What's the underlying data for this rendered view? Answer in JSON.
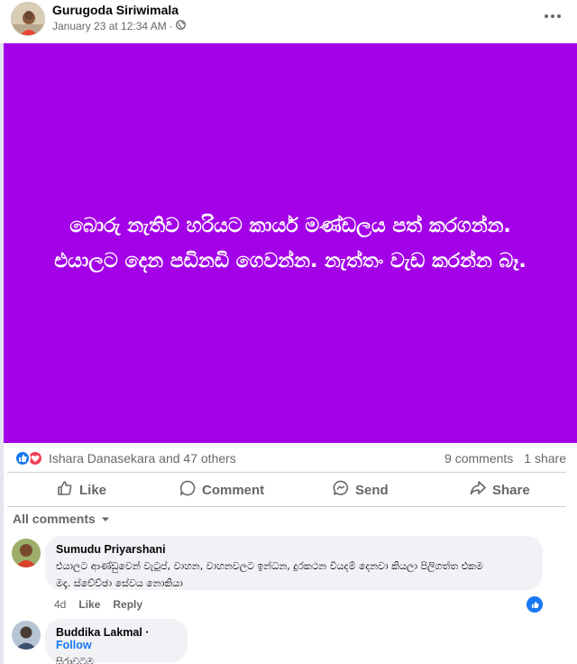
{
  "post": {
    "author": "Gurugoda Siriwimala",
    "timestamp": "January 23 at 12:34 AM",
    "separator": "·",
    "privacy_icon": "globe-icon",
    "more_icon": "more-options-icon"
  },
  "status": {
    "background": "#a300e8",
    "line1": "බොරු නැතිව හරියට කාර්ය මණ්ඩලය පත් කරගන්න.",
    "line2": "එයාලට දෙන පඩිනඩි ගෙවන්න. නැත්තං වැඩ කරන්න බෑ."
  },
  "reactions": {
    "icons": [
      "like-icon",
      "love-icon"
    ],
    "summary": "Ishara Danasekara and 47 others",
    "comments": "9 comments",
    "shares": "1 share"
  },
  "actions": {
    "like": "Like",
    "comment": "Comment",
    "send": "Send",
    "share": "Share"
  },
  "comments_filter": "All comments",
  "comments": [
    {
      "author": "Sumudu Priyarshani",
      "line1": "එයාලට ආණ්ඩුවෙන් වැටුප්, වාහන, වාහනවලට ඉන්ධන, දුරකථන වියදම් දෙනවා කියලා පිලිගත්ත එකම",
      "line2": "මදෑ. ස්වේච්ඡා සේවය නොකියා",
      "age": "4d",
      "like": "Like",
      "reply": "Reply"
    },
    {
      "author": "Buddika Lakmal",
      "separator": "·",
      "follow": "Follow",
      "text": "සිරාවටම"
    }
  ],
  "colors": {
    "accent": "#1877f2",
    "love": "#f33e58",
    "muted": "#65676b"
  }
}
